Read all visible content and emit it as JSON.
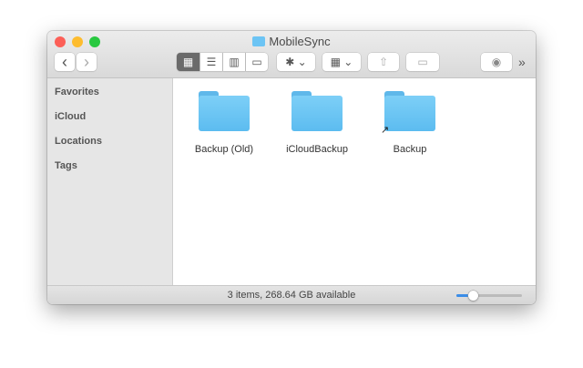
{
  "window": {
    "title": "MobileSync"
  },
  "toolbar": {
    "back": "‹",
    "forward": "›",
    "overflow": "»"
  },
  "sidebar": {
    "items": [
      {
        "label": "Favorites"
      },
      {
        "label": "iCloud"
      },
      {
        "label": "Locations"
      },
      {
        "label": "Tags"
      }
    ]
  },
  "files": [
    {
      "name": "Backup (Old)"
    },
    {
      "name": "iCloudBackup"
    },
    {
      "name": "Backup"
    }
  ],
  "status": {
    "text": "3 items, 268.64 GB available",
    "icon_size_slider": 0.25
  },
  "colors": {
    "folder": "#6cc4f4",
    "accent": "#3b8de8"
  }
}
